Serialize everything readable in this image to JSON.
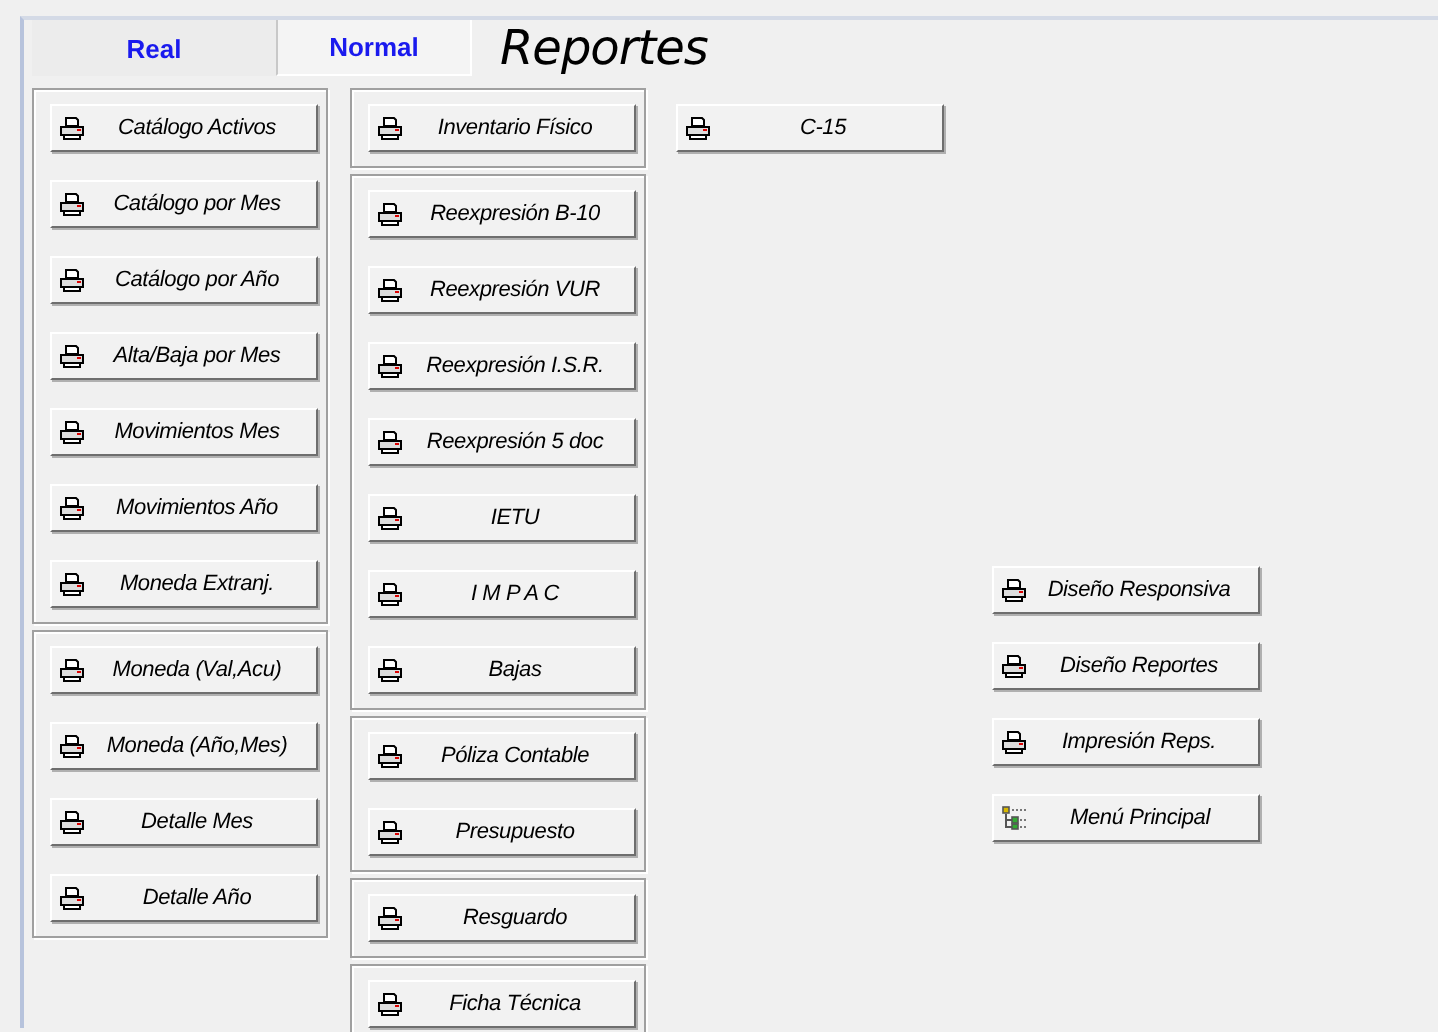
{
  "tabs": [
    {
      "label": "Real",
      "selected": false
    },
    {
      "label": "Normal",
      "selected": true
    }
  ],
  "title": "Reportes",
  "columns": [
    {
      "groups": [
        {
          "buttons": [
            {
              "label": "Catálogo Activos",
              "kind": "printer"
            },
            {
              "label": "Catálogo por Mes",
              "kind": "printer"
            },
            {
              "label": "Catálogo por Año",
              "kind": "printer"
            },
            {
              "label": "Alta/Baja por Mes",
              "kind": "printer"
            },
            {
              "label": "Movimientos Mes",
              "kind": "printer"
            },
            {
              "label": "Movimientos Año",
              "kind": "printer"
            },
            {
              "label": "Moneda Extranj.",
              "kind": "printer"
            }
          ]
        },
        {
          "buttons": [
            {
              "label": "Moneda (Val,Acu)",
              "kind": "printer"
            },
            {
              "label": "Moneda (Año,Mes)",
              "kind": "printer"
            },
            {
              "label": "Detalle Mes",
              "kind": "printer"
            },
            {
              "label": "Detalle Año",
              "kind": "printer"
            }
          ]
        }
      ]
    },
    {
      "groups": [
        {
          "buttons": [
            {
              "label": "Inventario Físico",
              "kind": "printer"
            }
          ]
        },
        {
          "buttons": [
            {
              "label": "Reexpresión B-10",
              "kind": "printer"
            },
            {
              "label": "Reexpresión VUR",
              "kind": "printer"
            },
            {
              "label": "Reexpresión I.S.R.",
              "kind": "printer"
            },
            {
              "label": "Reexpresión 5 doc",
              "kind": "printer"
            },
            {
              "label": "IETU",
              "kind": "printer"
            },
            {
              "label": "I M P A C",
              "kind": "printer"
            },
            {
              "label": "Bajas",
              "kind": "printer"
            }
          ]
        },
        {
          "buttons": [
            {
              "label": "Póliza Contable",
              "kind": "printer"
            },
            {
              "label": "Presupuesto",
              "kind": "printer"
            }
          ]
        },
        {
          "buttons": [
            {
              "label": "Resguardo",
              "kind": "printer"
            }
          ]
        },
        {
          "buttons": [
            {
              "label": "Ficha Técnica",
              "kind": "printer"
            }
          ]
        }
      ]
    },
    {
      "buttons": [
        {
          "label": "C-15",
          "kind": "printer"
        }
      ]
    },
    {
      "buttons": [
        {
          "label": "Diseño Responsiva",
          "kind": "printer"
        },
        {
          "label": "Diseño Reportes",
          "kind": "printer"
        },
        {
          "label": "Impresión Reps.",
          "kind": "printer"
        },
        {
          "label": "Menú Principal",
          "kind": "menu"
        }
      ]
    }
  ]
}
